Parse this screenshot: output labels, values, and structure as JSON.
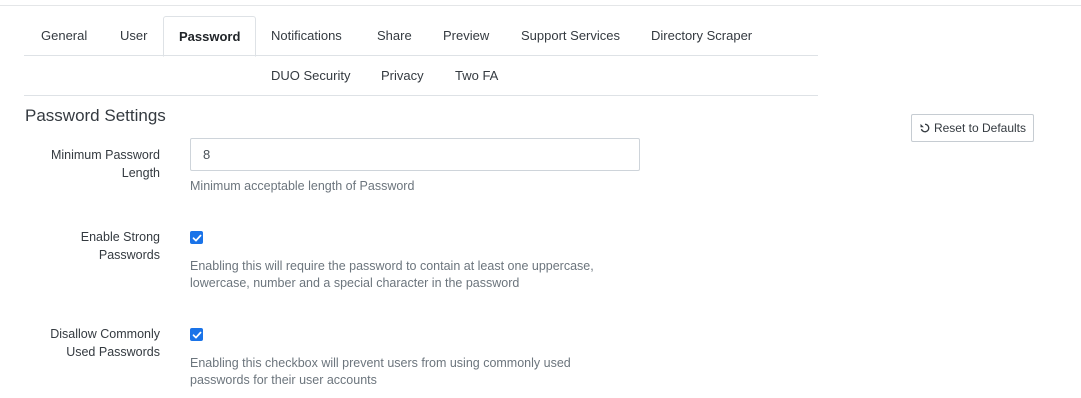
{
  "tabs": {
    "row1": [
      "General",
      "User",
      "Password",
      "Notifications",
      "Share",
      "Preview",
      "Support Services",
      "Directory Scraper"
    ],
    "row2": [
      "DUO Security",
      "Privacy",
      "Two FA"
    ],
    "active": "Password"
  },
  "section": {
    "title": "Password Settings",
    "reset_label": "Reset to Defaults"
  },
  "fields": {
    "min_length": {
      "label_line1": "Minimum Password",
      "label_line2": "Length",
      "value": "8",
      "help": "Minimum acceptable length of Password"
    },
    "strong": {
      "label_line1": "Enable Strong",
      "label_line2": "Passwords",
      "checked": true,
      "help_line1": "Enabling this will require the password to contain at least one uppercase,",
      "help_line2": "lowercase, number and a special character in the password"
    },
    "common": {
      "label_line1": "Disallow Commonly",
      "label_line2": "Used Passwords",
      "checked": true,
      "help_line1": "Enabling this checkbox will prevent users from using commonly used",
      "help_line2": "passwords for their user accounts"
    }
  },
  "colors": {
    "checkbox": "#1a73e8",
    "border": "#dee2e6"
  },
  "icons": {
    "reset": "undo-icon",
    "check": "checkmark-icon"
  }
}
